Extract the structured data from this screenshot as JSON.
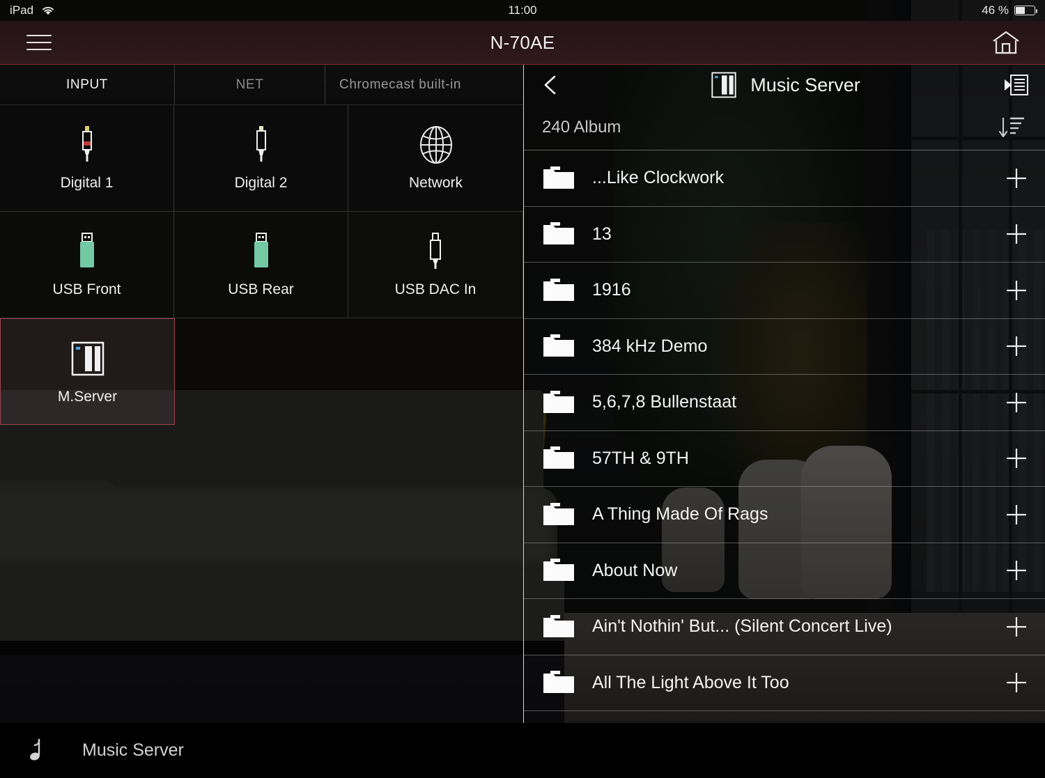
{
  "status_bar": {
    "device": "iPad",
    "wifi_icon": "wifi-icon",
    "time": "11:00",
    "battery_percent": "46 %",
    "battery_level": 46
  },
  "app_bar": {
    "menu_icon": "hamburger-menu-icon",
    "title": "N-70AE",
    "home_icon": "home-icon",
    "accent_color": "#7d2730"
  },
  "left_pane": {
    "tabs": [
      {
        "label": "INPUT",
        "active": true
      },
      {
        "label": "NET",
        "active": false
      },
      {
        "label": "Chromecast built-in",
        "active": false
      }
    ],
    "inputs": [
      {
        "label": "Digital 1",
        "icon": "coaxial-plug-icon",
        "selected": false
      },
      {
        "label": "Digital 2",
        "icon": "optical-plug-icon",
        "selected": false
      },
      {
        "label": "Network",
        "icon": "globe-icon",
        "selected": false
      },
      {
        "label": "USB Front",
        "icon": "usb-stick-icon",
        "selected": false
      },
      {
        "label": "USB Rear",
        "icon": "usb-stick-icon",
        "selected": false
      },
      {
        "label": "USB DAC In",
        "icon": "usb-b-plug-icon",
        "selected": false
      },
      {
        "label": "M.Server",
        "icon": "music-server-icon",
        "selected": true
      }
    ],
    "selected_color": "#9e4352",
    "usb_icon_color": "#74c9a5"
  },
  "right_pane": {
    "back_icon": "back-chevron-icon",
    "server_icon": "music-server-icon",
    "title": "Music Server",
    "queue_icon": "play-queue-icon",
    "count_label": "240 Album",
    "sort_icon": "sort-descending-icon",
    "add_icon": "plus-icon",
    "folder_icon": "folder-icon",
    "items": [
      {
        "name": "...Like Clockwork"
      },
      {
        "name": "13"
      },
      {
        "name": "1916"
      },
      {
        "name": "384 kHz Demo"
      },
      {
        "name": "5,6,7,8 Bullenstaat"
      },
      {
        "name": "57TH & 9TH"
      },
      {
        "name": "A Thing Made Of Rags"
      },
      {
        "name": "About Now"
      },
      {
        "name": "Ain't Nothin' But... (Silent Concert Live)"
      },
      {
        "name": "All The Light Above It Too"
      }
    ]
  },
  "now_playing_bar": {
    "icon": "music-note-icon",
    "source": "Music Server"
  }
}
